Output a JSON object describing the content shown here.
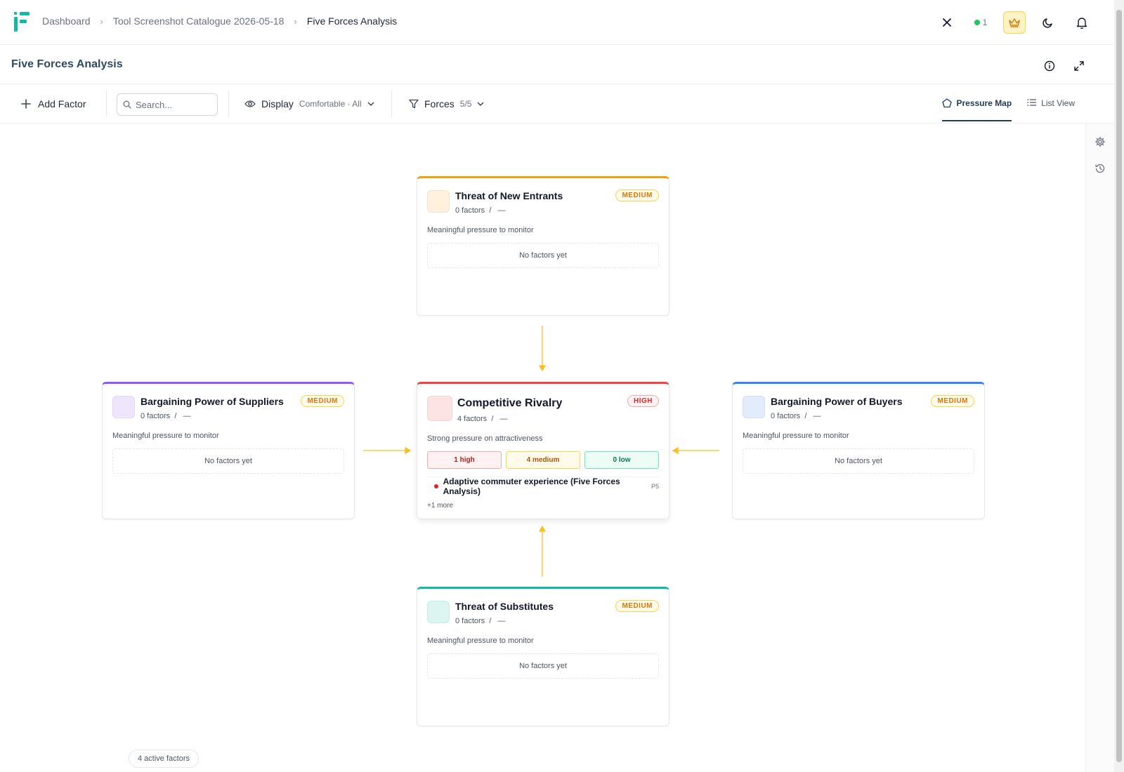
{
  "breadcrumb": {
    "items": [
      "Dashboard",
      "Tool Screenshot Catalogue 2026-05-18"
    ],
    "current": "Five Forces Analysis"
  },
  "topbar": {
    "online_count": "1"
  },
  "page": {
    "title": "Five Forces Analysis"
  },
  "toolbar": {
    "add_label": "Add Factor",
    "search_placeholder": "Search...",
    "display_label": "Display",
    "display_value": "Comfortable · All",
    "forces_label": "Forces",
    "forces_value": "5/5",
    "view_tabs": [
      "Pressure Map",
      "List View"
    ],
    "active_view": "Pressure Map"
  },
  "forces": {
    "new_entrants": {
      "title": "Threat of New Entrants",
      "count": "0 factors",
      "slash": "/",
      "dash": "—",
      "level": "MEDIUM",
      "description": "Meaningful pressure to monitor",
      "empty": "No factors yet",
      "color": "#f59e0b",
      "swatch": "#fff1dd"
    },
    "suppliers": {
      "title": "Bargaining Power of Suppliers",
      "count": "0 factors",
      "slash": "/",
      "dash": "—",
      "level": "MEDIUM",
      "description": "Meaningful pressure to monitor",
      "empty": "No factors yet",
      "color": "#8b5cf6",
      "swatch": "#efe6fd"
    },
    "rivalry": {
      "title": "Competitive Rivalry",
      "count": "4 factors",
      "slash": "/",
      "dash": "—",
      "level": "HIGH",
      "description": "Strong pressure on attractiveness",
      "chips": {
        "high": "1 high",
        "medium": "4 medium",
        "low": "0 low"
      },
      "top_factor": "Adaptive commuter experience (Five Forces Analysis)",
      "top_factor_tag": "P5",
      "more": "+1 more",
      "color": "#ef4444",
      "swatch": "#fde4e4"
    },
    "buyers": {
      "title": "Bargaining Power of Buyers",
      "count": "0 factors",
      "slash": "/",
      "dash": "—",
      "level": "MEDIUM",
      "description": "Meaningful pressure to monitor",
      "empty": "No factors yet",
      "color": "#3b82f6",
      "swatch": "#e3ecfd"
    },
    "substitutes": {
      "title": "Threat of Substitutes",
      "count": "0 factors",
      "slash": "/",
      "dash": "—",
      "level": "MEDIUM",
      "description": "Meaningful pressure to monitor",
      "empty": "No factors yet",
      "color": "#14b8a6",
      "swatch": "#dcf5f1"
    }
  },
  "footer": {
    "active_factors": "4 active factors"
  },
  "icons": {
    "close": "close-icon",
    "crown": "crown-icon",
    "theme": "moon-icon",
    "notifications": "bell-icon",
    "info": "info-icon",
    "expand": "expand-icon",
    "settings": "gear-icon",
    "history": "history-icon"
  }
}
